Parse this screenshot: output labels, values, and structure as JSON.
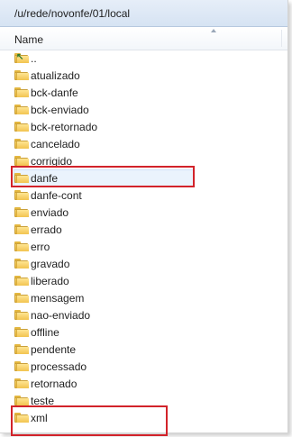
{
  "window": {
    "path": "/u/rede/novonfe/01/local",
    "column_name": "Name"
  },
  "colors": {
    "highlight_box": "#d2232a",
    "folder": "#f2c450",
    "selection": "#eaf3fd"
  },
  "files": [
    {
      "label": "..",
      "icon": "parent-folder-icon"
    },
    {
      "label": "atualizado",
      "icon": "folder-icon"
    },
    {
      "label": "bck-danfe",
      "icon": "folder-icon"
    },
    {
      "label": "bck-enviado",
      "icon": "folder-icon"
    },
    {
      "label": "bck-retornado",
      "icon": "folder-icon"
    },
    {
      "label": "cancelado",
      "icon": "folder-icon"
    },
    {
      "label": "corrigido",
      "icon": "folder-icon"
    },
    {
      "label": "danfe",
      "icon": "folder-icon",
      "selected": true
    },
    {
      "label": "danfe-cont",
      "icon": "folder-icon"
    },
    {
      "label": "enviado",
      "icon": "folder-icon"
    },
    {
      "label": "errado",
      "icon": "folder-icon"
    },
    {
      "label": "erro",
      "icon": "folder-icon"
    },
    {
      "label": "gravado",
      "icon": "folder-icon"
    },
    {
      "label": "liberado",
      "icon": "folder-icon"
    },
    {
      "label": "mensagem",
      "icon": "folder-icon"
    },
    {
      "label": "nao-enviado",
      "icon": "folder-icon"
    },
    {
      "label": "offline",
      "icon": "folder-icon"
    },
    {
      "label": "pendente",
      "icon": "folder-icon"
    },
    {
      "label": "processado",
      "icon": "folder-icon"
    },
    {
      "label": "retornado",
      "icon": "folder-icon"
    },
    {
      "label": "teste",
      "icon": "folder-icon"
    },
    {
      "label": "xml",
      "icon": "folder-icon"
    }
  ]
}
